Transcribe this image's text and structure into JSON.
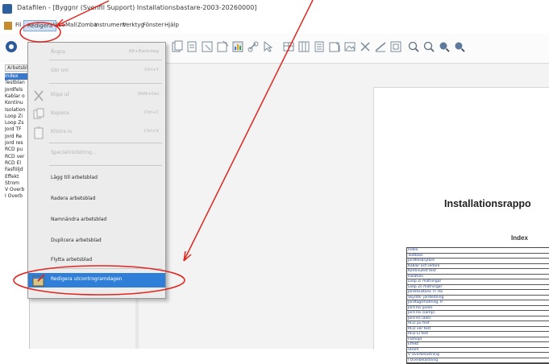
{
  "window": {
    "title": "Datafilen - [Byggnr (Svenfil Support) Installationsbastare-2003-20260000]"
  },
  "menubar": {
    "items": [
      "Fil",
      "Redigera",
      "Visa",
      "Mall",
      "Zomba",
      "Instrument",
      "Verktyg",
      "Fönster",
      "Hjälp"
    ],
    "active": "Redigera"
  },
  "left_panel": {
    "tab": "Arbetsbl",
    "sheets": [
      "Index",
      "Testblan",
      "Jordfels",
      "Kablar o",
      "Kontinu",
      "Isolation",
      "Loop Zi",
      "Loop Zs",
      "Jord TF",
      "Jord Re",
      "Jord res",
      "RCD pu",
      "RCD ver",
      "RCD El",
      "Fasföljd",
      "Effekt",
      "Strom",
      "V Överb",
      "I Överb"
    ],
    "selected": "Index"
  },
  "edit_menu": {
    "items": [
      {
        "label": "Ångra",
        "shortcut": "Alt+Backsteg",
        "enabled": false
      },
      {
        "label": "Gör om",
        "shortcut": "Ctrl+Y",
        "enabled": false
      },
      {
        "label": "Klipp ut",
        "shortcut": "Shift+Del",
        "enabled": false
      },
      {
        "label": "Kopiera",
        "shortcut": "Ctrl+C",
        "enabled": false
      },
      {
        "label": "Klistra in",
        "shortcut": "Ctrl+V",
        "enabled": false
      },
      {
        "label": "Specialinklistring...",
        "shortcut": "",
        "enabled": false
      },
      {
        "label": "Lägg till arbetsblad",
        "shortcut": "",
        "enabled": true
      },
      {
        "label": "Radera arbetsblad",
        "shortcut": "",
        "enabled": true
      },
      {
        "label": "Namnändra arbetsblad",
        "shortcut": "",
        "enabled": true
      },
      {
        "label": "Duplicera arbetsblad",
        "shortcut": "",
        "enabled": true
      },
      {
        "label": "Flytta arbetsblad",
        "shortcut": "",
        "enabled": true
      },
      {
        "label": "Redigera utcontrogramdagen",
        "shortcut": "",
        "enabled": true,
        "highlighted": true
      }
    ]
  },
  "document": {
    "heading": "Installationsrappo",
    "subheading": "Index",
    "index_rows": [
      "Index",
      "Testblan",
      "Jordfelsbrytare",
      "Kablar och ledare",
      "Kontinuitet test",
      "Isolation",
      "Loop Zi mätningar",
      "Loop Zs mätningar",
      "Jordresistans TF Ra",
      "Skydds- jordledning",
      "Jordtagsmätning, IF",
      "Jord Ra (pole)",
      "Jord Ra (samp)",
      "Jord Rs (alle)",
      "RCD pu test",
      "RCD ver test",
      "RCD El test",
      "Fasföljd",
      "Effekt",
      "Strom",
      "V Överbelastning",
      "I Överbelastning"
    ]
  },
  "annotations": {
    "color": "#e0261f"
  }
}
